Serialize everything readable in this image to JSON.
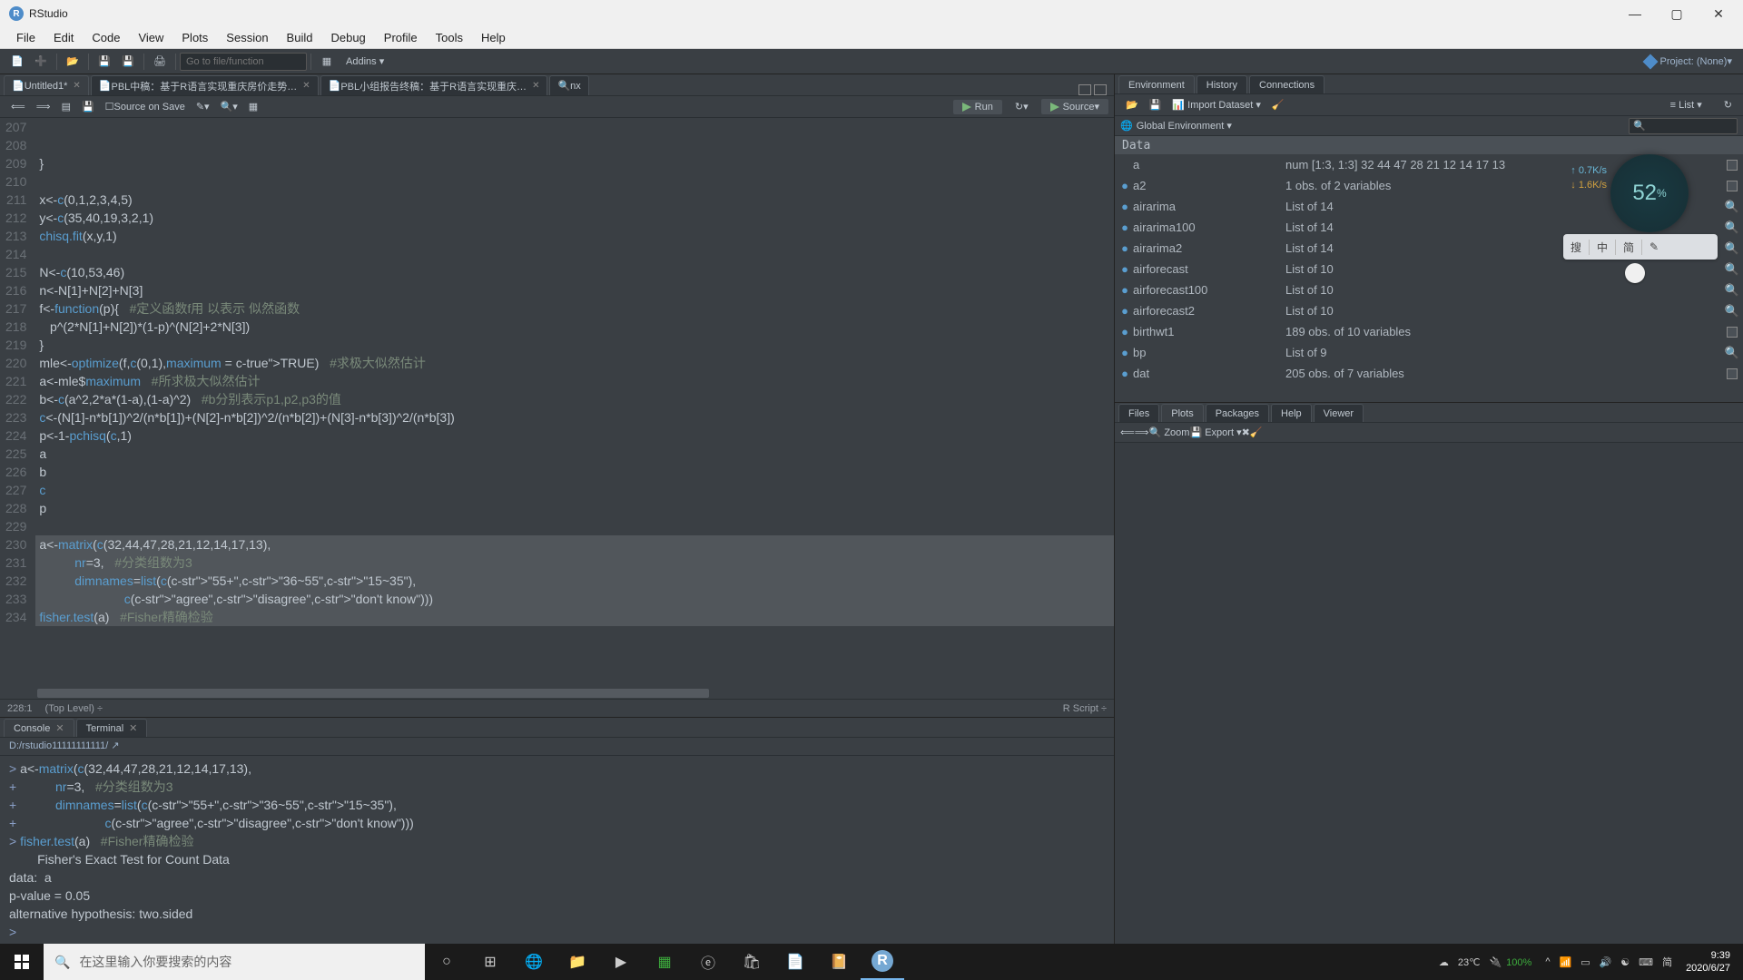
{
  "titlebar": {
    "app": "RStudio"
  },
  "menubar": [
    "File",
    "Edit",
    "Code",
    "View",
    "Plots",
    "Session",
    "Build",
    "Debug",
    "Profile",
    "Tools",
    "Help"
  ],
  "toolbar": {
    "goto": "Go to file/function",
    "addins": "Addins",
    "project": "Project: (None)"
  },
  "source": {
    "tabs": [
      {
        "label": "Untitled1*",
        "active": true
      },
      {
        "label": "PBL中稿：基于R语言实现重庆房价走势…"
      },
      {
        "label": "PBL小组报告终稿：基于R语言实现重庆…"
      },
      {
        "label": "nx",
        "search": true
      }
    ],
    "tb": {
      "sourceOnSave": "Source on Save",
      "run": "Run",
      "source": "Source"
    },
    "status": {
      "pos": "228:1",
      "level": "(Top Level)",
      "mode": "R Script"
    },
    "code": {
      "start": 207,
      "lines": [
        "}",
        "",
        "x<-c(0,1,2,3,4,5)",
        "y<-c(35,40,19,3,2,1)",
        "chisq.fit(x,y,1)",
        "",
        "N<-c(10,53,46)",
        "n<-N[1]+N[2]+N[3]",
        "f<-function(p){   #定义函数f用 以表示 似然函数",
        "   p^(2*N[1]+N[2])*(1-p)^(N[2]+2*N[3])",
        "}",
        "mle<-optimize(f,c(0,1),maximum = TRUE)   #求极大似然估计",
        "a<-mle$maximum   #所求极大似然估计",
        "b<-c(a^2,2*a*(1-a),(1-a)^2)   #b分别表示p1,p2,p3的值",
        "c<-(N[1]-n*b[1])^2/(n*b[1])+(N[2]-n*b[2])^2/(n*b[2])+(N[3]-n*b[3])^2/(n*b[3])",
        "p<-1-pchisq(c,1)",
        "a",
        "b",
        "c",
        "p",
        "",
        "a<-matrix(c(32,44,47,28,21,12,14,17,13),",
        "          nr=3,   #分类组数为3",
        "          dimnames=list(c(\"55+\",\"36~55\",\"15~35\"),",
        "                        c(\"agree\",\"disagree\",\"don't know\")))",
        "fisher.test(a)   #Fisher精确检验",
        "",
        ""
      ],
      "selected": [
        21,
        22,
        23,
        24,
        25
      ]
    }
  },
  "console": {
    "tabs": [
      "Console",
      "Terminal"
    ],
    "path": "D:/rstudio11111111111/",
    "outLines": [
      "> a<-matrix(c(32,44,47,28,21,12,14,17,13),",
      "+           nr=3,   #分类组数为3",
      "+           dimnames=list(c(\"55+\",\"36~55\",\"15~35\"),",
      "+                         c(\"agree\",\"disagree\",\"don't know\")))",
      "> fisher.test(a)   #Fisher精确检验",
      "",
      "        Fisher's Exact Test for Count Data",
      "",
      "data:  a",
      "p-value = 0.05",
      "alternative hypothesis: two.sided",
      "",
      "> "
    ]
  },
  "env": {
    "tabs": [
      "Environment",
      "History",
      "Connections"
    ],
    "tb": {
      "import": "Import Dataset",
      "list": "List"
    },
    "global": "Global Environment",
    "dataHead": "Data",
    "rows": [
      {
        "exp": "",
        "name": "a",
        "value": "num [1:3, 1:3] 32 44 47 28 21 12 14 17 13",
        "tbl": true
      },
      {
        "exp": "●",
        "name": "a2",
        "value": "1 obs. of 2 variables",
        "tbl": true
      },
      {
        "exp": "●",
        "name": "airarima",
        "value": "List of 14",
        "mag": true
      },
      {
        "exp": "●",
        "name": "airarima100",
        "value": "List of 14",
        "mag": true
      },
      {
        "exp": "●",
        "name": "airarima2",
        "value": "List of 14",
        "mag": true
      },
      {
        "exp": "●",
        "name": "airforecast",
        "value": "List of 10",
        "mag": true
      },
      {
        "exp": "●",
        "name": "airforecast100",
        "value": "List of 10",
        "mag": true
      },
      {
        "exp": "●",
        "name": "airforecast2",
        "value": "List of 10",
        "mag": true
      },
      {
        "exp": "●",
        "name": "birthwt1",
        "value": "189 obs. of 10 variables",
        "tbl": true
      },
      {
        "exp": "●",
        "name": "bp",
        "value": "List of 9",
        "mag": true
      },
      {
        "exp": "●",
        "name": "dat",
        "value": "205 obs. of 7 variables",
        "tbl": true
      }
    ]
  },
  "plots": {
    "tabs": [
      "Files",
      "Plots",
      "Packages",
      "Help",
      "Viewer"
    ],
    "active": 1,
    "tb": {
      "zoom": "Zoom",
      "export": "Export"
    }
  },
  "overlay": {
    "percent": "52",
    "up": "0.7K/s",
    "down": "1.6K/s"
  },
  "switcher": [
    "搜",
    "中",
    "简",
    "✎"
  ],
  "taskbar": {
    "searchPlaceholder": "在这里输入你要搜索的内容",
    "temp": "23℃",
    "battery": "100%",
    "ime": "简",
    "time": "9:39",
    "date": "2020/6/27"
  }
}
